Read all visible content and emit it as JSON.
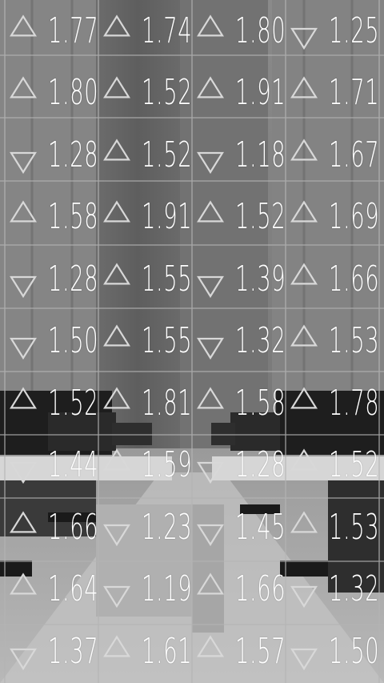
{
  "ticker": {
    "rows": [
      [
        {
          "value": "1.77",
          "direction": "up"
        },
        {
          "value": "1.74",
          "direction": "up"
        },
        {
          "value": "1.80",
          "direction": "up"
        },
        {
          "value": "1.25",
          "direction": "down"
        }
      ],
      [
        {
          "value": "1.80",
          "direction": "up"
        },
        {
          "value": "1.52",
          "direction": "up"
        },
        {
          "value": "1.91",
          "direction": "up"
        },
        {
          "value": "1.71",
          "direction": "up"
        }
      ],
      [
        {
          "value": "1.28",
          "direction": "down"
        },
        {
          "value": "1.52",
          "direction": "up"
        },
        {
          "value": "1.18",
          "direction": "down"
        },
        {
          "value": "1.67",
          "direction": "up"
        }
      ],
      [
        {
          "value": "1.58",
          "direction": "up"
        },
        {
          "value": "1.91",
          "direction": "up"
        },
        {
          "value": "1.52",
          "direction": "up"
        },
        {
          "value": "1.69",
          "direction": "up"
        }
      ],
      [
        {
          "value": "1.28",
          "direction": "down"
        },
        {
          "value": "1.55",
          "direction": "up"
        },
        {
          "value": "1.39",
          "direction": "down"
        },
        {
          "value": "1.66",
          "direction": "up"
        }
      ],
      [
        {
          "value": "1.50",
          "direction": "down"
        },
        {
          "value": "1.55",
          "direction": "up"
        },
        {
          "value": "1.32",
          "direction": "down"
        },
        {
          "value": "1.53",
          "direction": "up"
        }
      ],
      [
        {
          "value": "1.52",
          "direction": "up"
        },
        {
          "value": "1.81",
          "direction": "up"
        },
        {
          "value": "1.58",
          "direction": "up"
        },
        {
          "value": "1.78",
          "direction": "up"
        }
      ],
      [
        {
          "value": "1.44",
          "direction": "down"
        },
        {
          "value": "1.59",
          "direction": "up"
        },
        {
          "value": "1.28",
          "direction": "down"
        },
        {
          "value": "1.52",
          "direction": "up"
        }
      ],
      [
        {
          "value": "1.66",
          "direction": "up"
        },
        {
          "value": "1.23",
          "direction": "down"
        },
        {
          "value": "1.45",
          "direction": "down"
        },
        {
          "value": "1.53",
          "direction": "up"
        }
      ],
      [
        {
          "value": "1.64",
          "direction": "up"
        },
        {
          "value": "1.19",
          "direction": "down"
        },
        {
          "value": "1.66",
          "direction": "up"
        },
        {
          "value": "1.32",
          "direction": "down"
        }
      ],
      [
        {
          "value": "1.37",
          "direction": "down"
        },
        {
          "value": "1.61",
          "direction": "up"
        },
        {
          "value": "1.57",
          "direction": "up"
        },
        {
          "value": "1.50",
          "direction": "down"
        }
      ]
    ]
  },
  "colors": {
    "text": "#ffffff",
    "arrow_stroke": "#d8d8d8",
    "grid_line": "#b4b4b4"
  },
  "icons": {
    "up": "triangle-up-outline",
    "down": "triangle-down-outline"
  }
}
